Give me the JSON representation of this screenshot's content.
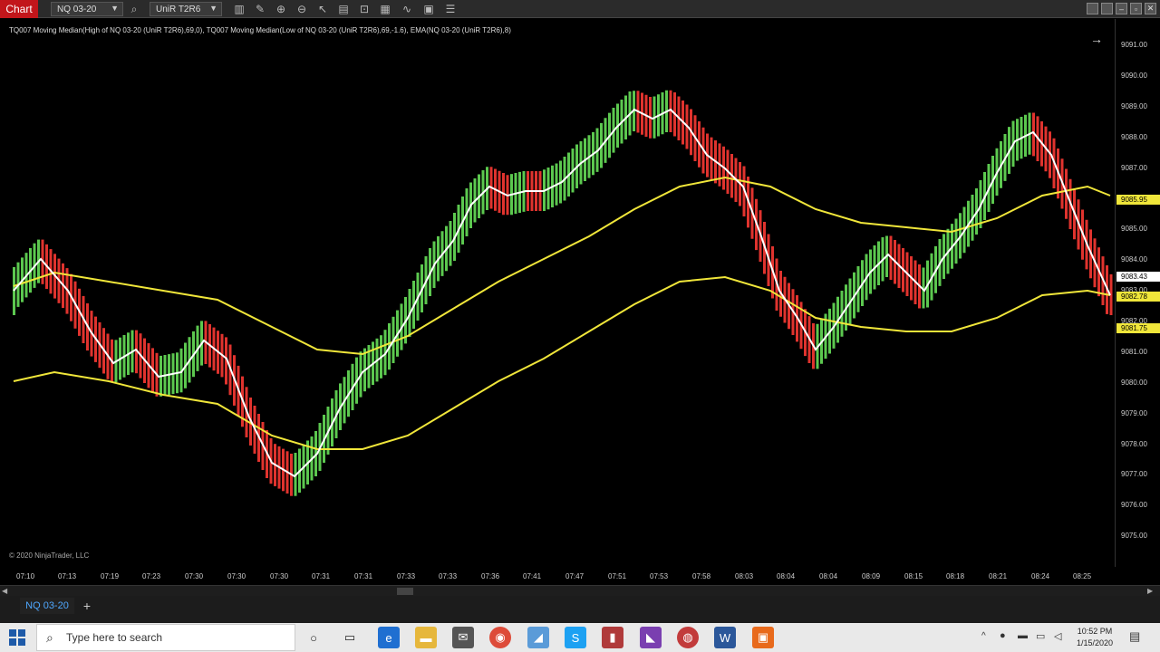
{
  "toolbar": {
    "chart_tab": "Chart",
    "instrument": "NQ 03-20",
    "bar_type": "UniR T2R6"
  },
  "chart": {
    "indicator_label": "TQ007 Moving Median(High of NQ 03-20 (UniR T2R6),69,0), TQ007 Moving Median(Low of NQ 03-20 (UniR T2R6),69,-1.6), EMA(NQ 03-20 (UniR T2R6),8)",
    "copyright": "© 2020 NinjaTrader, LLC",
    "price_ticks": [
      "9091.00",
      "9090.00",
      "9089.00",
      "9088.00",
      "9087.00",
      "9085.00",
      "9084.00",
      "9083.00",
      "9082.00",
      "9081.00",
      "9080.00",
      "9079.00",
      "9078.00",
      "9077.00",
      "9076.00",
      "9075.00"
    ],
    "price_tags": [
      "9085.95",
      "9083.43",
      "9082.78",
      "9081.75"
    ],
    "time_ticks": [
      "07:10",
      "07:13",
      "07:19",
      "07:23",
      "07:30",
      "07:30",
      "07:30",
      "07:31",
      "07:31",
      "07:33",
      "07:33",
      "07:36",
      "07:41",
      "07:47",
      "07:51",
      "07:53",
      "07:58",
      "08:03",
      "08:04",
      "08:04",
      "08:09",
      "08:15",
      "08:18",
      "08:21",
      "08:24",
      "08:25"
    ],
    "colors": {
      "up": "#5cc84f",
      "down": "#e0332e",
      "band": "#f0e63a",
      "ema": "#ffffff"
    }
  },
  "tabs": {
    "active": "NQ 03-20",
    "add": "+"
  },
  "taskbar": {
    "search_placeholder": "Type here to search",
    "time": "10:52 PM",
    "date": "1/15/2020"
  }
}
